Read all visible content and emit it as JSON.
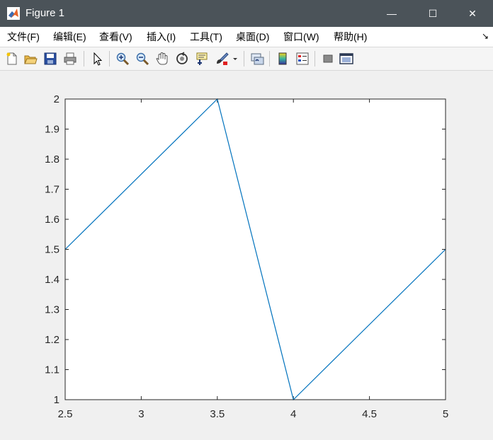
{
  "window": {
    "title": "Figure 1",
    "controls": {
      "minimize": "—",
      "maximize": "☐",
      "close": "✕"
    }
  },
  "menu": {
    "items": [
      {
        "label": "文件(F)"
      },
      {
        "label": "编辑(E)"
      },
      {
        "label": "查看(V)"
      },
      {
        "label": "插入(I)"
      },
      {
        "label": "工具(T)"
      },
      {
        "label": "桌面(D)"
      },
      {
        "label": "窗口(W)"
      },
      {
        "label": "帮助(H)"
      }
    ],
    "overflow_icon": "dock-arrow-icon"
  },
  "toolbar": {
    "tools": [
      "new-figure-icon",
      "open-file-icon",
      "save-icon",
      "print-icon",
      "select-pointer-icon",
      "zoom-in-icon",
      "zoom-out-icon",
      "pan-hand-icon",
      "rotate-3d-icon",
      "data-cursor-icon",
      "brush-icon",
      "link-plot-icon",
      "colorbar-icon",
      "legend-icon",
      "hide-plot-tools-icon",
      "show-plot-tools-icon"
    ]
  },
  "colors": {
    "titlebar": "#4b5359",
    "line": "#0072bd",
    "axes_bg": "#ffffff",
    "figure_bg": "#f0f0f0"
  },
  "chart_data": {
    "type": "line",
    "x": [
      2.5,
      3.5,
      4,
      5
    ],
    "series": [
      {
        "values": [
          1.5,
          2,
          1,
          1.5
        ]
      }
    ],
    "xlim": [
      2.5,
      5
    ],
    "ylim": [
      1,
      2
    ],
    "xticks": [
      "2.5",
      "3",
      "3.5",
      "4",
      "4.5",
      "5"
    ],
    "yticks": [
      "1",
      "1.1",
      "1.2",
      "1.3",
      "1.4",
      "1.5",
      "1.6",
      "1.7",
      "1.8",
      "1.9",
      "2"
    ],
    "title": "",
    "xlabel": "",
    "ylabel": "",
    "grid": false
  }
}
